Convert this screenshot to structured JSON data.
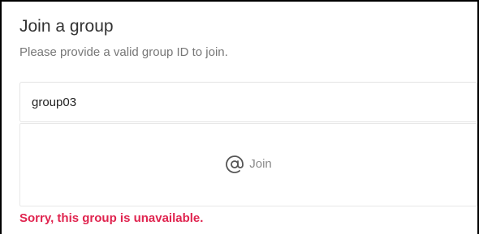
{
  "dialog": {
    "title": "Join a group",
    "subtitle": "Please provide a valid group ID to join.",
    "group_id_input": {
      "value": "group03"
    },
    "join_button": {
      "label": "Join",
      "icon": "at-sign-icon"
    },
    "error_message": "Sorry, this group is unavailable."
  },
  "colors": {
    "error": "#e0244f",
    "border": "#e3e3e3",
    "muted_text": "#777777"
  }
}
